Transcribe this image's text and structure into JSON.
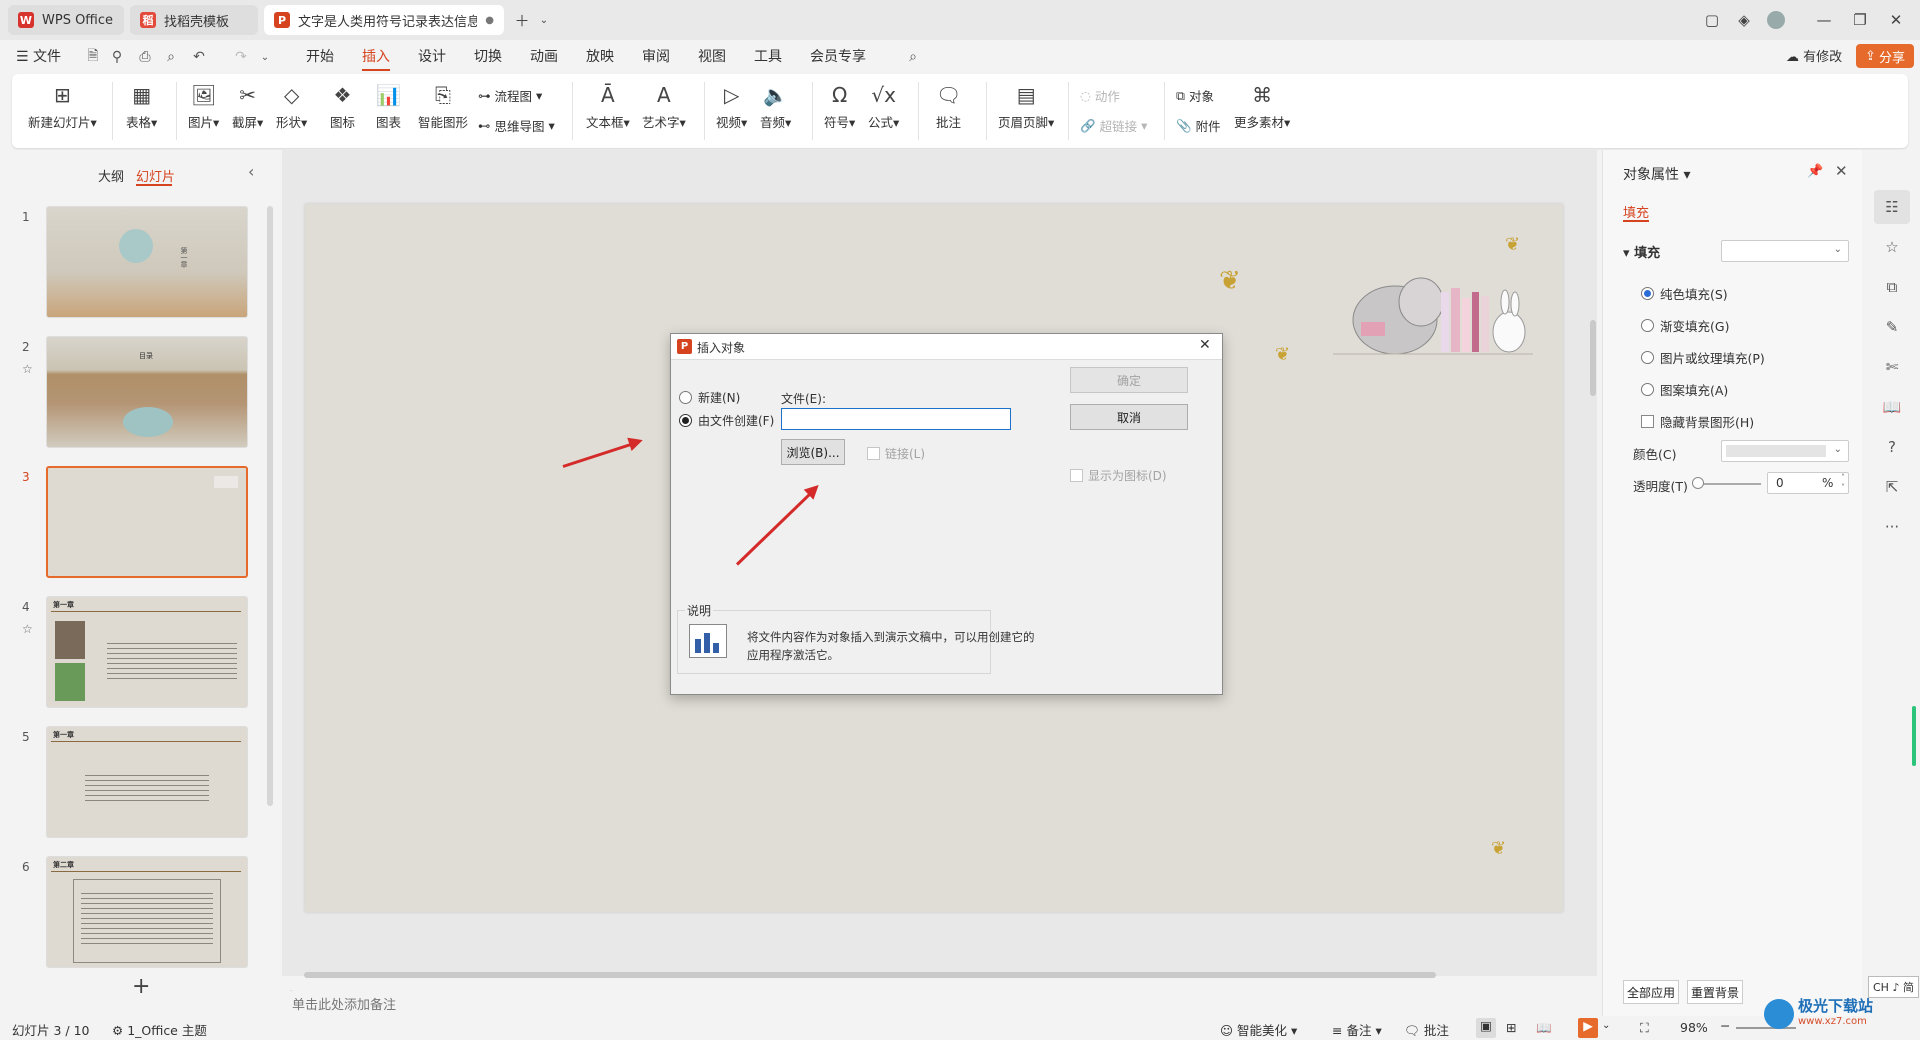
{
  "titlebar": {
    "tabs": [
      {
        "label": "WPS Office"
      },
      {
        "label": "找稻壳模板"
      },
      {
        "label": "文字是人类用符号记录表达信息以"
      }
    ]
  },
  "menubar": {
    "file": "文件",
    "tabs": [
      "开始",
      "插入",
      "设计",
      "切换",
      "动画",
      "放映",
      "审阅",
      "视图",
      "工具",
      "会员专享"
    ],
    "active_tab": "插入",
    "has_changes": "有修改",
    "share": "分享"
  },
  "ribbon": {
    "new_slide": "新建幻灯片",
    "table": "表格",
    "picture": "图片",
    "screenshot": "截屏",
    "shape": "形状",
    "icon": "图标",
    "chart": "图表",
    "smart_graphic": "智能图形",
    "flowchart": "流程图",
    "mindmap": "思维导图",
    "textbox": "文本框",
    "wordart": "艺术字",
    "video": "视频",
    "audio": "音频",
    "symbol": "符号",
    "formula": "公式",
    "comment": "批注",
    "header_footer": "页眉页脚",
    "action": "动作",
    "hyperlink": "超链接",
    "object": "对象",
    "attachment": "附件",
    "more_material": "更多素材"
  },
  "leftpanel": {
    "outline": "大纲",
    "slides": "幻灯片",
    "thumbs": [
      {
        "num": "1",
        "chapter": "第一章"
      },
      {
        "num": "2",
        "title": "目录"
      },
      {
        "num": "3"
      },
      {
        "num": "4",
        "chapter": "第一章"
      },
      {
        "num": "5",
        "chapter": "第一章"
      },
      {
        "num": "6",
        "chapter": "第二章"
      }
    ]
  },
  "notes_placeholder": "单击此处添加备注",
  "dialog": {
    "title": "插入对象",
    "new_label": "新建(N)",
    "from_file_label": "由文件创建(F)",
    "file_label": "文件(E):",
    "file_value": "",
    "browse": "浏览(B)...",
    "link": "链接(L)",
    "ok": "确定",
    "cancel": "取消",
    "show_as_icon": "显示为图标(D)",
    "desc_title": "说明",
    "desc_text_1": "将文件内容作为对象插入到演示文稿中，可以用创建它的",
    "desc_text_2": "应用程序激活它。"
  },
  "rightpanel": {
    "title": "对象属性",
    "tab_fill": "填充",
    "section_fill": "填充",
    "solid": "纯色填充(S)",
    "gradient": "渐变填充(G)",
    "picture_texture": "图片或纹理填充(P)",
    "pattern": "图案填充(A)",
    "hide_bg": "隐藏背景图形(H)",
    "color": "颜色(C)",
    "transparency": "透明度(T)",
    "transparency_value": "0",
    "percent": "%",
    "apply_all": "全部应用",
    "reset_bg": "重置背景"
  },
  "statusbar": {
    "slide_info": "幻灯片 3 / 10",
    "theme": "1_Office 主题",
    "smart_beautify": "智能美化",
    "notes": "备注",
    "comments": "批注",
    "zoom": "98%",
    "ime": "CH ♪ 简",
    "watermark": "极光下载站",
    "watermark_url": "www.xz7.com"
  },
  "colors": {
    "accent": "#d5441f",
    "share_bg": "#e56a2b",
    "arrow": "#d42a2a"
  }
}
